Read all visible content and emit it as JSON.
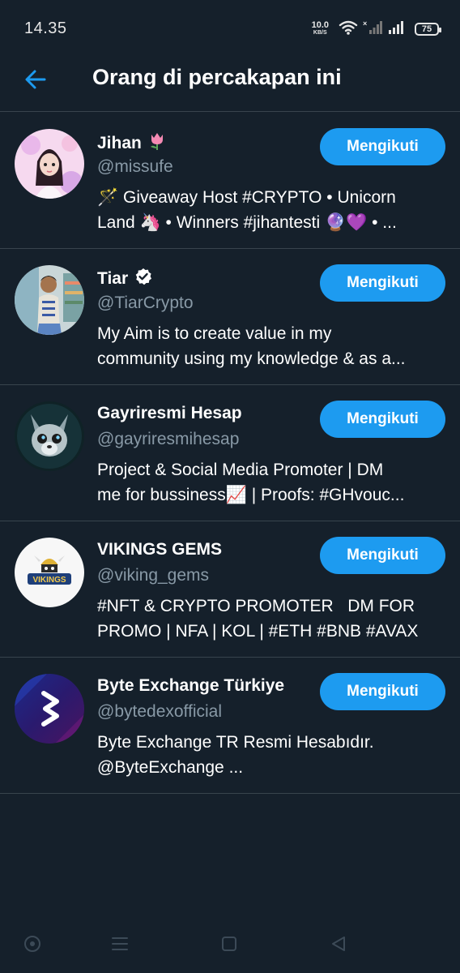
{
  "status_bar": {
    "time": "14.35",
    "net_speed_value": "10.0",
    "net_speed_unit": "KB/S",
    "battery": "75"
  },
  "header": {
    "title": "Orang di percakapan ini"
  },
  "users": [
    {
      "name": "Jihan",
      "handle": "@missufe",
      "bio_line1": "🪄 Giveaway Host #CRYPTO • Unicorn",
      "bio_line2": "Land 🦄 • Winners #jihantesti 🔮💜 • ...",
      "follow_label": "Mengikuti"
    },
    {
      "name": "Tiar",
      "handle": "@TiarCrypto",
      "bio_line1": "My Aim is to create value in my",
      "bio_line2": "community using my knowledge & as a...",
      "follow_label": "Mengikuti"
    },
    {
      "name": "Gayriresmi Hesap",
      "handle": "@gayriresmihesap",
      "bio_line1": "Project & Social Media Promoter | DM",
      "bio_line2": "me for bussiness📈 | Proofs: #GHvouc...",
      "follow_label": "Mengikuti"
    },
    {
      "name": "VIKINGS GEMS",
      "handle": "@viking_gems",
      "bio_line1": "#NFT & CRYPTO PROMOTER   DM FOR",
      "bio_line2": "PROMO | NFA | KOL | #ETH #BNB #AVAX",
      "follow_label": "Mengikuti",
      "avatar_text": "VIKINGS"
    },
    {
      "name": "Byte Exchange Türkiye",
      "handle": "@bytedexofficial",
      "bio_line1": "Byte Exchange TR Resmi Hesabıdır.",
      "bio_line2": "@ByteExchange ...",
      "follow_label": "Mengikuti"
    }
  ],
  "icons": {
    "back": "arrow-left-icon",
    "tulip": "tulip-icon",
    "verified": "verified-badge-icon",
    "wifi": "wifi-icon",
    "signal": "signal-icon",
    "battery": "battery-icon"
  },
  "colors": {
    "background": "#15202b",
    "accent": "#1d9bf0",
    "divider": "#38444d",
    "secondary_text": "#8899a6"
  }
}
